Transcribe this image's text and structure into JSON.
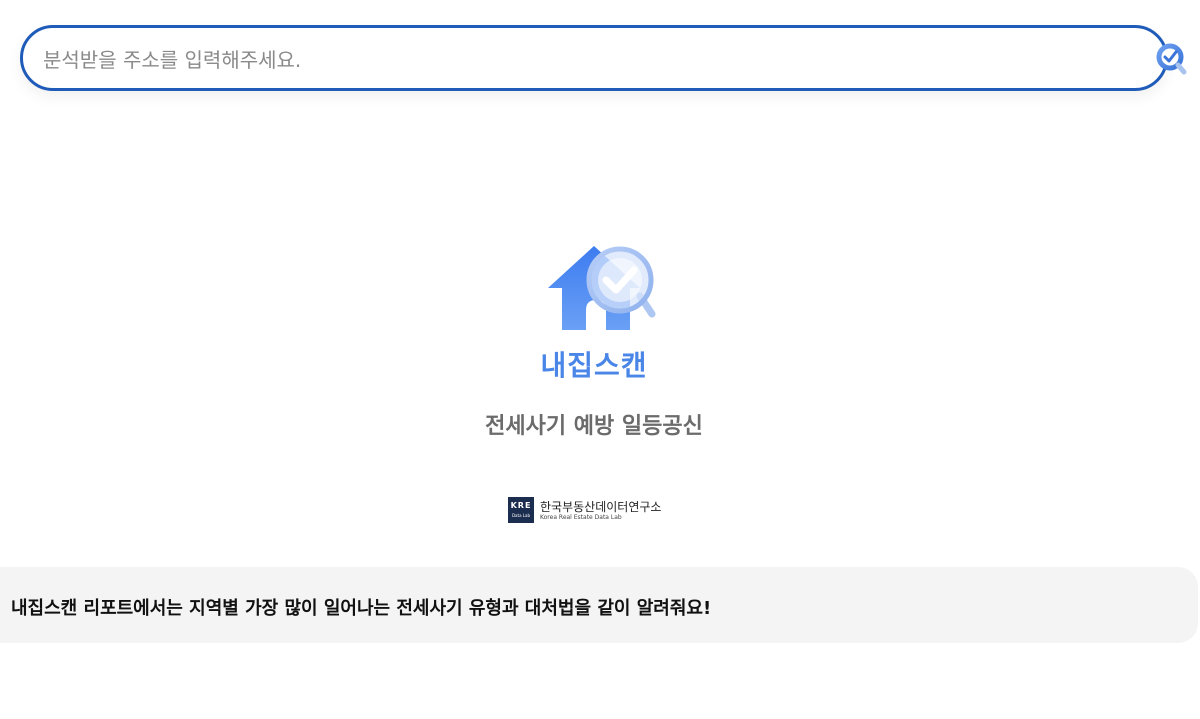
{
  "search": {
    "placeholder": "분석받을 주소를 입력해주세요.",
    "value": ""
  },
  "brand": {
    "name": "내집스캔",
    "tagline": "전세사기 예방 일등공신",
    "icon": "house-check-magnifier-icon",
    "accent_color": "#4a86e8"
  },
  "organization": {
    "logo_text": "KRE",
    "logo_subtext": "Data Lab",
    "name": "한국부동산데이터연구소",
    "name_en": "Korea Real Estate Data Lab"
  },
  "banner": {
    "text": "내집스캔 리포트에서는 지역별 가장 많이 일어나는 전세사기 유형과 대처법을 같이 알려줘요!"
  },
  "colors": {
    "search_border": "#1f5bb8",
    "banner_bg": "#f4f4f4"
  }
}
